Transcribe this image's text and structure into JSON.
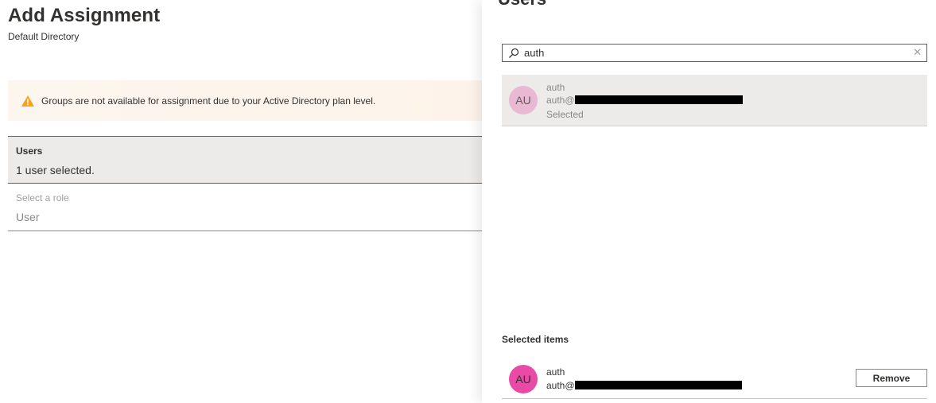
{
  "left_pane": {
    "title": "Add Assignment",
    "subtitle": "Default Directory",
    "warning": {
      "icon": "warning-icon",
      "text": "Groups are not available for assignment due to your Active Directory plan level.",
      "color": "#f7a21b"
    },
    "users_field": {
      "label": "Users",
      "value": "1 user selected."
    },
    "role_field": {
      "label": "Select a role",
      "value": "User"
    }
  },
  "right_pane": {
    "title": "Users",
    "search": {
      "value": "auth",
      "icon": "search-icon",
      "clear_icon": "close-icon",
      "clear_glyph": "✕"
    },
    "results": [
      {
        "initials": "AU",
        "name": "auth",
        "email_prefix": "auth@",
        "status": "Selected"
      }
    ],
    "selected_heading": "Selected items",
    "selected_items": [
      {
        "initials": "AU",
        "name": "auth",
        "email_prefix": "auth@",
        "remove_label": "Remove"
      }
    ]
  },
  "colors": {
    "avatar_light": "#e9b8d3",
    "avatar_dark": "#e84aa6",
    "selected_row_bg": "#edebe9"
  }
}
